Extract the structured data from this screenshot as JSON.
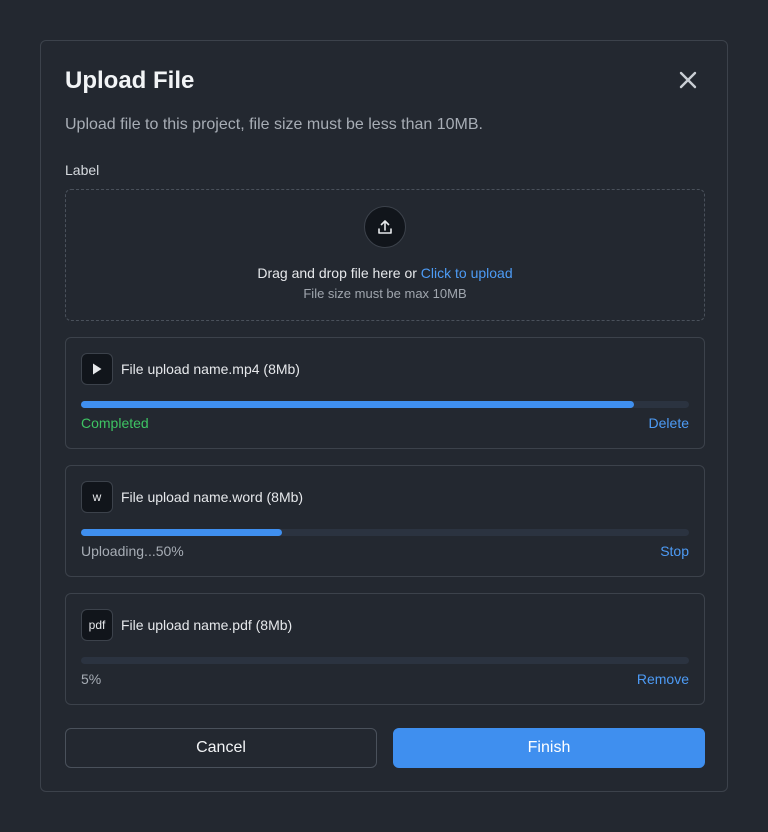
{
  "dialog": {
    "title": "Upload File",
    "subtitle": "Upload file to this project, file size must be less than 10MB.",
    "close_icon": "close-icon"
  },
  "dropzone": {
    "label": "Label",
    "icon": "upload-icon",
    "text": "Drag and drop file here or ",
    "link": "Click to upload",
    "hint": "File size must be max 10MB"
  },
  "files": [
    {
      "icon": "play-icon",
      "icon_text": "",
      "name": "File upload name.mp4 (8Mb)",
      "progress": 0.91,
      "status": "Completed",
      "action": "Delete"
    },
    {
      "icon": "word-icon",
      "icon_text": "w",
      "name": "File upload name.word (8Mb)",
      "progress": 0.33,
      "status": "Uploading...50%",
      "action": "Stop"
    },
    {
      "icon": "pdf-icon",
      "icon_text": "pdf",
      "name": "File upload name.pdf (8Mb)",
      "progress": 0.0,
      "status": "5%",
      "action": "Remove"
    }
  ],
  "buttons": {
    "cancel": "Cancel",
    "finish": "Finish"
  },
  "colors": {
    "accent": "#3f8fef",
    "success": "#3ec463",
    "link": "#4d9bf5"
  }
}
